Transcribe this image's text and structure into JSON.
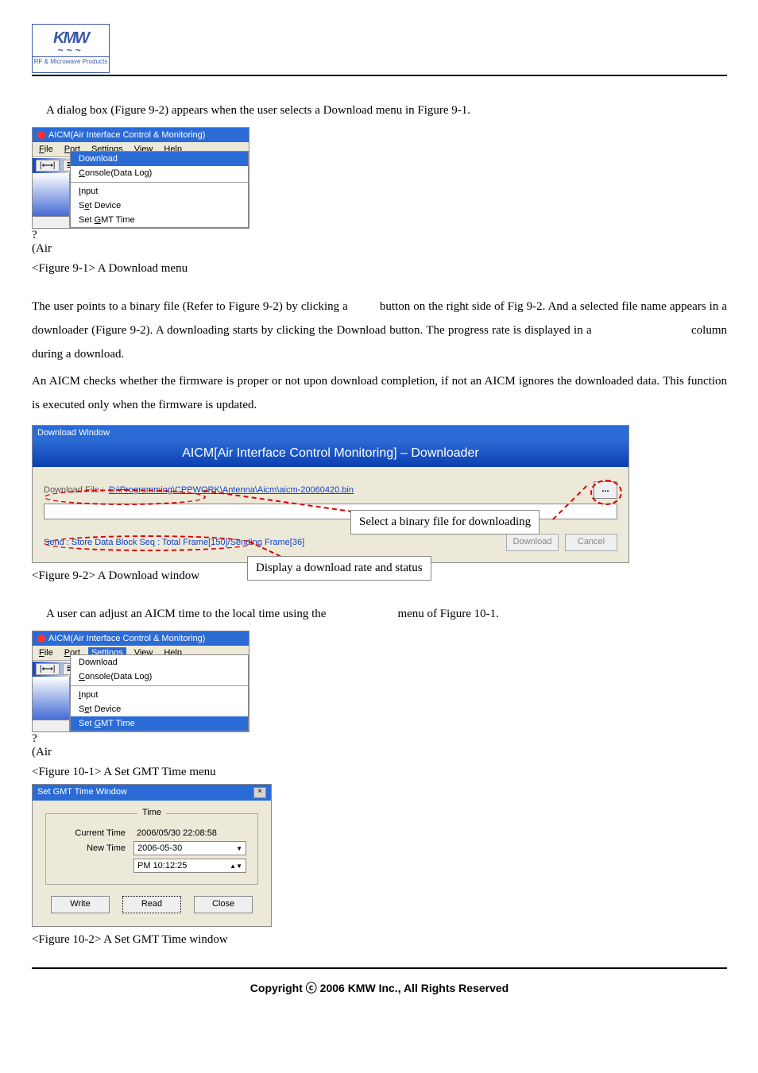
{
  "logo": {
    "big": "KMW",
    "wave": "~~~",
    "tag": "RF & Microwave Products"
  },
  "text": {
    "p1": "A dialog box (Figure 9-2) appears when the user selects a Download menu in Figure 9-1.",
    "cap1": "<Figure 9-1> A Download menu",
    "p2a": "The user points to a binary file (Refer to Figure 9-2) by clicking a",
    "p2b": "button on the right side of Fig 9-2. And a selected file name appears in a downloader (Figure 9-2). A downloading starts by clicking the Download button. The progress rate is displayed in a",
    "p2c": "column during a download.",
    "p3": "An AICM checks whether the firmware is proper or not upon download completion, if not an AICM ignores the downloaded data. This function is executed only when the firmware is updated.",
    "cap2": "<Figure 9-2> A Download window",
    "p4a": "A user can adjust an AICM time to the local time using the",
    "p4b": "menu of Figure 10-1.",
    "cap3": "<Figure 10-1> A Set GMT Time menu",
    "cap4": "<Figure 10-2> A Set GMT Time window",
    "copyright": "Copyright ⓒ 2006 KMW Inc., All Rights Reserved"
  },
  "menuwin": {
    "title": "AICM(Air Interface Control & Monitoring)",
    "menubar": {
      "file": "File",
      "port": "Port",
      "settings": "Settings",
      "view": "View",
      "help": "Help"
    },
    "submenu": {
      "download": "Download",
      "console": "Console(Data Log)",
      "input": "Input",
      "setdevice": "Set Device",
      "setgmt": "Set GMT Time"
    },
    "air": "(Air",
    "help": "?"
  },
  "dl": {
    "title": "Download Window",
    "banner": "AICM[Air Interface Control Monitoring]  –  Downloader",
    "label": "Download File  :",
    "path": "D:\\Programming\\CPPWORK\\Antenna\\Aicm\\aicm-20060420.bin",
    "browse": "...",
    "status": "Send : Store Data Block Seq : Total Frame[150]/Sending Frame[36]",
    "download_btn": "Download",
    "cancel_btn": "Cancel",
    "callout1": "Select a binary file for downloading",
    "callout2": "Display a download rate and status"
  },
  "gmt": {
    "title": "Set GMT Time Window",
    "group": "Time",
    "current_lbl": "Current Time",
    "current_val": "2006/05/30  22:08:58",
    "new_lbl": "New Time",
    "date": "2006-05-30",
    "time": "PM  10:12:25",
    "write": "Write",
    "read": "Read",
    "close": "Close"
  }
}
